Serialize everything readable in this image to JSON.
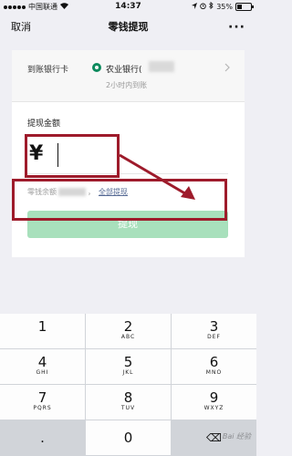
{
  "status_bar": {
    "carrier": "中国联通",
    "wifi_icon": "wifi-icon",
    "time": "14:37",
    "battery_percent": "35%",
    "icons": [
      "location-icon",
      "alarm-icon",
      "bluetooth-icon"
    ]
  },
  "nav": {
    "cancel_label": "取消",
    "title": "零钱提现",
    "more_label": "···"
  },
  "bank_card": {
    "label": "到账银行卡",
    "bank_name": "农业银行(",
    "arrival_time": "2小时内到账"
  },
  "amount": {
    "label": "提现金额",
    "currency_symbol": "¥",
    "value": ""
  },
  "balance": {
    "prefix": "零钱余额",
    "separator": "，",
    "all_link": "全部提现"
  },
  "withdraw_button": {
    "label": "提现",
    "enabled": false
  },
  "keypad": {
    "keys": [
      {
        "num": "1",
        "sub": ""
      },
      {
        "num": "2",
        "sub": "ABC"
      },
      {
        "num": "3",
        "sub": "DEF"
      },
      {
        "num": "4",
        "sub": "GHI"
      },
      {
        "num": "5",
        "sub": "JKL"
      },
      {
        "num": "6",
        "sub": "MNO"
      },
      {
        "num": "7",
        "sub": "PQRS"
      },
      {
        "num": "8",
        "sub": "TUV"
      },
      {
        "num": "9",
        "sub": "WXYZ"
      },
      {
        "num": ".",
        "sub": ""
      },
      {
        "num": "0",
        "sub": ""
      },
      {
        "num": "⌫",
        "sub": ""
      }
    ]
  },
  "colors": {
    "accent_green": "#a8e0bc",
    "annotation_red": "#9e1b2b",
    "link_blue": "#576b95",
    "bank_green": "#0c8a5d"
  },
  "watermark": "Bai 经验"
}
